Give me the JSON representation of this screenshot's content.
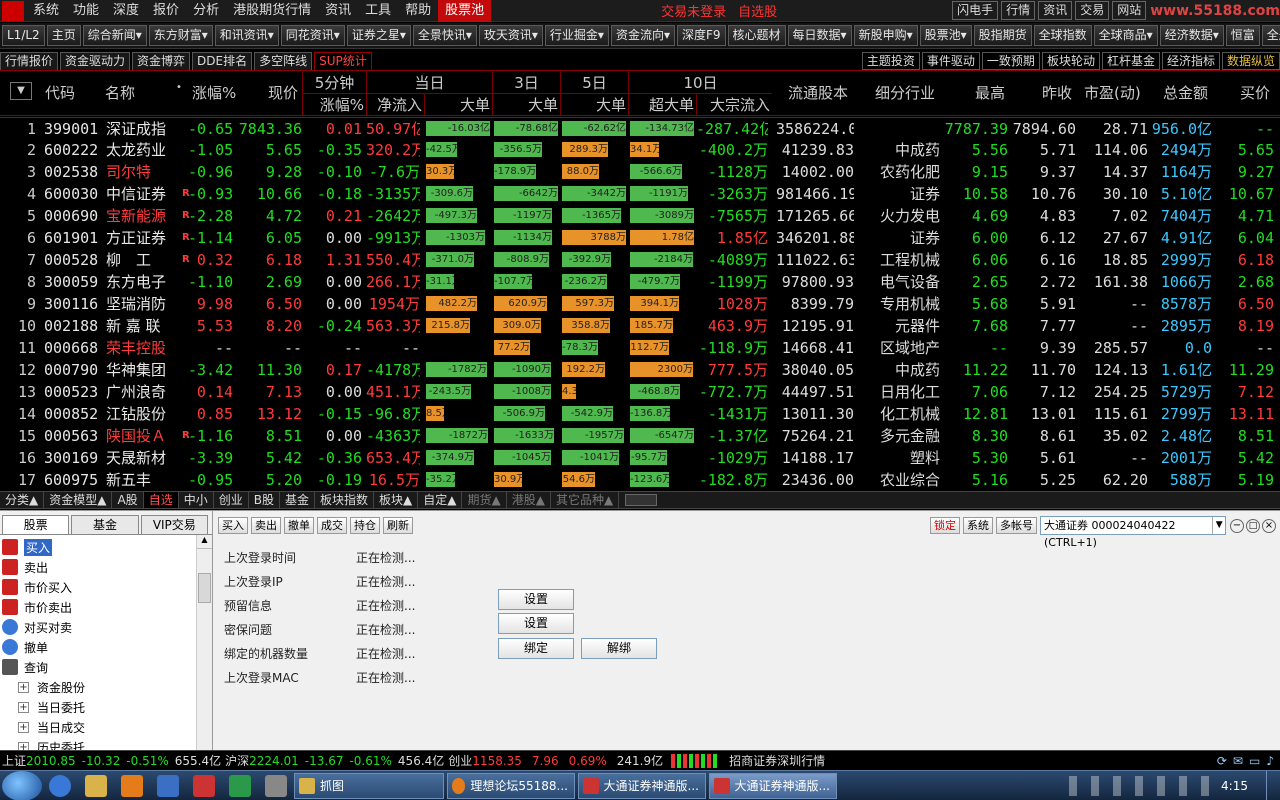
{
  "menu": {
    "items": [
      "系统",
      "功能",
      "深度",
      "报价",
      "分析",
      "港股期货行情",
      "资讯",
      "工具",
      "帮助",
      "股票池"
    ],
    "active": "股票池",
    "status_not_logged": "交易未登录",
    "status_watch": "自选股",
    "right": [
      "闪电手",
      "行情",
      "资讯",
      "交易",
      "网站"
    ],
    "watermark": "www.55188.com"
  },
  "toolbar": [
    "L1/L2",
    "主页",
    "综合新闻▾",
    "东方财富▾",
    "和讯资讯▾",
    "同花资讯▾",
    "证券之星▾",
    "全景快讯▾",
    "玫天资讯▾",
    "行业掘金▾",
    "资金流向▾",
    "深度F9",
    "核心题材",
    "每日数据▾",
    "新股申购▾",
    "股票池▾",
    "股指期货",
    "全球指数",
    "全球商品▾",
    "经济数据▾",
    "恒富",
    "全般"
  ],
  "tabs2": {
    "left": [
      "行情报价",
      "资金驱动力",
      "资金博弈",
      "DDE排名",
      "多空阵线",
      "SUP统计"
    ],
    "active": "SUP统计",
    "right": [
      "主题投资",
      "事件驱动",
      "一致预期",
      "板块轮动",
      "杠杆基金",
      "经济指标",
      "数据纵览"
    ]
  },
  "columns": {
    "code": "代码",
    "name": "名称",
    "change_pct": "涨幅%",
    "price": "现价",
    "grp_5min": "5分钟",
    "sub_5min": "涨幅%",
    "grp_day": "当日",
    "sub_net": "净流入",
    "sub_big": "大单",
    "grp_3d": "3日",
    "sub_3d": "大单",
    "grp_5d": "5日",
    "sub_5d": "大单",
    "grp_10d": "10日",
    "sub_super": "超大单",
    "sub_block": "大宗流入",
    "float": "流通股本",
    "industry": "细分行业",
    "high": "最高",
    "prev": "昨收",
    "pe": "市盈(动)",
    "amount": "总金额",
    "buy": "买价"
  },
  "colors": {
    "up": "#ff3b3b",
    "down": "#22dd22",
    "flat": "#dddddd",
    "inflow_bar": "#e8922a",
    "outflow_bar": "#4fb84f",
    "code": "#e6e6e6",
    "cyan": "#3cc8ff"
  },
  "rows": [
    {
      "n": "1",
      "code": "399001",
      "name": "深证成指",
      "nc": "#e8e8e8",
      "flag": "",
      "chg": "-0.65",
      "price": "7843.36",
      "m5": "0.01",
      "net": "50.97亿",
      "big": "-16.03亿",
      "b3": "-78.68亿",
      "b5": "-62.62亿",
      "sup": "-134.73亿",
      "blk": "-287.42亿",
      "float": "3586224.00",
      "ind": "",
      "high": "7787.39",
      "prev": "7894.60",
      "pe": "28.71",
      "amt": "956.0亿",
      "buy": "--"
    },
    {
      "n": "2",
      "code": "600222",
      "name": "太龙药业",
      "nc": "#e8e8e8",
      "flag": "",
      "chg": "-1.05",
      "price": "5.65",
      "m5": "-0.35",
      "net": "320.2万",
      "big": "-42.5万",
      "b3": "-356.5万",
      "b5": "289.3万",
      "sup": "34.1万",
      "blk": "-400.2万",
      "float": "41239.83",
      "ind": "中成药",
      "high": "5.56",
      "prev": "5.71",
      "pe": "114.06",
      "amt": "2494万",
      "buy": "5.65"
    },
    {
      "n": "3",
      "code": "002538",
      "name": "司尔特",
      "nc": "#ff3b3b",
      "flag": "",
      "chg": "-0.96",
      "price": "9.28",
      "m5": "-0.10",
      "net": "-7.6万",
      "big": "30.3万",
      "b3": "-178.9万",
      "b5": "88.0万",
      "sup": "-566.6万",
      "blk": "-1128万",
      "float": "14002.00",
      "ind": "农药化肥",
      "high": "9.15",
      "prev": "9.37",
      "pe": "14.37",
      "amt": "1164万",
      "buy": "9.27"
    },
    {
      "n": "4",
      "code": "600030",
      "name": "中信证券",
      "nc": "#e8e8e8",
      "flag": "R",
      "chg": "-0.93",
      "price": "10.66",
      "m5": "-0.18",
      "net": "-3135万",
      "big": "-309.6万",
      "b3": "-6642万",
      "b5": "-3442万",
      "sup": "-1191万",
      "blk": "-3263万",
      "float": "981466.19",
      "ind": "证券",
      "high": "10.58",
      "prev": "10.76",
      "pe": "30.10",
      "amt": "5.10亿",
      "buy": "10.67"
    },
    {
      "n": "5",
      "code": "000690",
      "name": "宝新能源",
      "nc": "#ff3b3b",
      "flag": "R",
      "chg": "-2.28",
      "price": "4.72",
      "m5": "0.21",
      "net": "-2642万",
      "big": "-497.3万",
      "b3": "-1197万",
      "b5": "-1365万",
      "sup": "-3089万",
      "blk": "-7565万",
      "float": "171265.66",
      "ind": "火力发电",
      "high": "4.69",
      "prev": "4.83",
      "pe": "7.02",
      "amt": "7404万",
      "buy": "4.71"
    },
    {
      "n": "6",
      "code": "601901",
      "name": "方正证券",
      "nc": "#e8e8e8",
      "flag": "R",
      "chg": "-1.14",
      "price": "6.05",
      "m5": "0.00",
      "net": "-9913万",
      "big": "-1303万",
      "b3": "-1134万",
      "b5": "3788万",
      "sup": "1.78亿",
      "blk": "1.85亿",
      "float": "346201.88",
      "ind": "证券",
      "high": "6.00",
      "prev": "6.12",
      "pe": "27.67",
      "amt": "4.91亿",
      "buy": "6.04"
    },
    {
      "n": "7",
      "code": "000528",
      "name": "柳　工",
      "nc": "#e8e8e8",
      "flag": "R",
      "chg": "0.32",
      "price": "6.18",
      "m5": "1.31",
      "net": "550.4万",
      "big": "-371.0万",
      "b3": "-808.9万",
      "b5": "-392.9万",
      "sup": "-2184万",
      "blk": "-4089万",
      "float": "111022.63",
      "ind": "工程机械",
      "high": "6.06",
      "prev": "6.16",
      "pe": "18.85",
      "amt": "2999万",
      "buy": "6.18"
    },
    {
      "n": "8",
      "code": "300059",
      "name": "东方电子",
      "nc": "#e8e8e8",
      "flag": "",
      "chg": "-1.10",
      "price": "2.69",
      "m5": "0.00",
      "net": "266.1万",
      "big": "-31.1万",
      "b3": "-107.7万",
      "b5": "-236.2万",
      "sup": "-479.7万",
      "blk": "-1199万",
      "float": "97800.93",
      "ind": "电气设备",
      "high": "2.65",
      "prev": "2.72",
      "pe": "161.38",
      "amt": "1066万",
      "buy": "2.68"
    },
    {
      "n": "9",
      "code": "300116",
      "name": "坚瑞消防",
      "nc": "#e8e8e8",
      "flag": "",
      "chg": "9.98",
      "price": "6.50",
      "m5": "0.00",
      "net": "1954万",
      "big": "482.2万",
      "b3": "620.9万",
      "b5": "597.3万",
      "sup": "394.1万",
      "blk": "1028万",
      "float": "8399.79",
      "ind": "专用机械",
      "high": "5.68",
      "prev": "5.91",
      "pe": "--",
      "amt": "8578万",
      "buy": "6.50"
    },
    {
      "n": "10",
      "code": "002188",
      "name": "新 嘉 联",
      "nc": "#e8e8e8",
      "flag": "",
      "chg": "5.53",
      "price": "8.20",
      "m5": "-0.24",
      "net": "563.3万",
      "big": "215.8万",
      "b3": "309.0万",
      "b5": "358.8万",
      "sup": "185.7万",
      "blk": "463.9万",
      "float": "12195.91",
      "ind": "元器件",
      "high": "7.68",
      "prev": "7.77",
      "pe": "--",
      "amt": "2895万",
      "buy": "8.19"
    },
    {
      "n": "11",
      "code": "000668",
      "name": "荣丰控股",
      "nc": "#ff3b3b",
      "flag": "",
      "chg": "--",
      "price": "--",
      "m5": "--",
      "net": "--",
      "big": "",
      "b3": "77.2万",
      "b5": "-78.3万",
      "sup": "112.7万",
      "blk": "-118.9万",
      "float": "14668.41",
      "ind": "区域地产",
      "high": "--",
      "prev": "9.39",
      "pe": "285.57",
      "amt": "0.0",
      "buy": "--"
    },
    {
      "n": "12",
      "code": "000790",
      "name": "华神集团",
      "nc": "#e8e8e8",
      "flag": "",
      "chg": "-3.42",
      "price": "11.30",
      "m5": "0.17",
      "net": "-4178万",
      "big": "-1782万",
      "b3": "-1090万",
      "b5": "192.2万",
      "sup": "2300万",
      "blk": "777.5万",
      "float": "38040.05",
      "ind": "中成药",
      "high": "11.22",
      "prev": "11.70",
      "pe": "124.13",
      "amt": "1.61亿",
      "buy": "11.29"
    },
    {
      "n": "13",
      "code": "000523",
      "name": "广州浪奇",
      "nc": "#e8e8e8",
      "flag": "",
      "chg": "0.14",
      "price": "7.13",
      "m5": "0.00",
      "net": "451.1万",
      "big": "-243.5万",
      "b3": "-1008万",
      "b5": "4.3万",
      "sup": "-468.8万",
      "blk": "-772.7万",
      "float": "44497.51",
      "ind": "日用化工",
      "high": "7.06",
      "prev": "7.12",
      "pe": "254.25",
      "amt": "5729万",
      "buy": "7.12"
    },
    {
      "n": "14",
      "code": "000852",
      "name": "江钻股份",
      "nc": "#e8e8e8",
      "flag": "",
      "chg": "0.85",
      "price": "13.12",
      "m5": "-0.15",
      "net": "-96.8万",
      "big": "8.5万",
      "b3": "-506.9万",
      "b5": "-542.9万",
      "sup": "-136.8万",
      "blk": "-1431万",
      "float": "13011.30",
      "ind": "化工机械",
      "high": "12.81",
      "prev": "13.01",
      "pe": "115.61",
      "amt": "2799万",
      "buy": "13.11"
    },
    {
      "n": "15",
      "code": "000563",
      "name": "陕国投Ａ",
      "nc": "#ff3b3b",
      "flag": "R",
      "chg": "-1.16",
      "price": "8.51",
      "m5": "0.00",
      "net": "-4363万",
      "big": "-1872万",
      "b3": "-1633万",
      "b5": "-1957万",
      "sup": "-6547万",
      "blk": "-1.37亿",
      "float": "75264.21",
      "ind": "多元金融",
      "high": "8.30",
      "prev": "8.61",
      "pe": "35.02",
      "amt": "2.48亿",
      "buy": "8.51"
    },
    {
      "n": "16",
      "code": "300169",
      "name": "天晟新材",
      "nc": "#e8e8e8",
      "flag": "",
      "chg": "-3.39",
      "price": "5.42",
      "m5": "-0.36",
      "net": "653.4万",
      "big": "-374.9万",
      "b3": "-1045万",
      "b5": "-1041万",
      "sup": "-95.7万",
      "blk": "-1029万",
      "float": "14188.17",
      "ind": "塑料",
      "high": "5.30",
      "prev": "5.61",
      "pe": "--",
      "amt": "2001万",
      "buy": "5.42"
    },
    {
      "n": "17",
      "code": "600975",
      "name": "新五丰",
      "nc": "#e8e8e8",
      "flag": "",
      "chg": "-0.95",
      "price": "5.20",
      "m5": "-0.19",
      "net": "16.5万",
      "big": "-35.2万",
      "b3": "30.9万",
      "b5": "54.6万",
      "sup": "-123.6万",
      "blk": "-182.8万",
      "float": "23436.00",
      "ind": "农业综合",
      "high": "5.16",
      "prev": "5.25",
      "pe": "62.20",
      "amt": "588万",
      "buy": "5.19"
    }
  ],
  "bottom_tabs": [
    "分类▲",
    "资金模型▲",
    "A股",
    "自选",
    "中小",
    "创业",
    "B股",
    "基金",
    "板块指数",
    "板块▲",
    "自定▲",
    "期货▲",
    "港股▲",
    "其它品种▲"
  ],
  "bottom_active": "自选",
  "trade": {
    "tabs": [
      "股票",
      "基金",
      "VIP交易"
    ],
    "tree": [
      "买入",
      "卖出",
      "市价买入",
      "市价卖出",
      "对买对卖",
      "撤单",
      "查询"
    ],
    "tree_sub": [
      "资金股份",
      "当日委托",
      "当日成交",
      "历史委托"
    ],
    "toolbar": [
      "买入",
      "卖出",
      "撤单",
      "成交",
      "持仓",
      "刷新"
    ],
    "right_btns": [
      "锁定",
      "系统",
      "多帐号"
    ],
    "account": "大通证券  000024040422 (CTRL+1)",
    "form": [
      {
        "label": "上次登录时间",
        "value": "正在检测..."
      },
      {
        "label": "上次登录IP",
        "value": "正在检测..."
      },
      {
        "label": "预留信息",
        "value": "正在检测..."
      },
      {
        "label": "密保问题",
        "value": "正在检测..."
      },
      {
        "label": "绑定的机器数量",
        "value": "正在检测..."
      },
      {
        "label": "上次登录MAC",
        "value": "正在检测..."
      }
    ],
    "btn_set1": "设置",
    "btn_set2": "设置",
    "btn_bind": "绑定",
    "btn_unbind": "解绑"
  },
  "statusbar": {
    "sh_label": "上证",
    "sh_val": "2010.85",
    "sh_chg": "-10.32",
    "sh_pct": "-0.51%",
    "sh_amt": "655.4亿",
    "hs_label": "沪深",
    "hs_val": "2224.01",
    "hs_chg": "-13.67",
    "hs_pct": "-0.61%",
    "hs_amt": "456.4亿",
    "cy_label": "创业",
    "cy_val": "1158.35",
    "cy_chg": "7.96",
    "cy_pct": "0.69%",
    "cy_amt": "241.9亿",
    "source": "招商证券深圳行情"
  },
  "taskbar": {
    "tasks": [
      "抓图",
      "理想论坛55188...",
      "大通证券神通版...",
      "大通证券神通版..."
    ],
    "clock": "4:15"
  }
}
